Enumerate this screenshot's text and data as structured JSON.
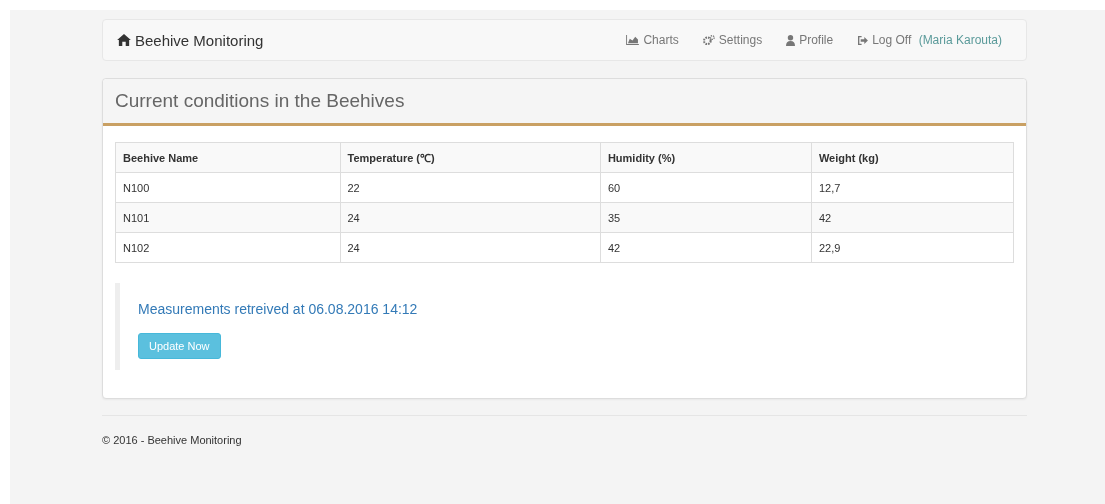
{
  "brand": {
    "label": "Beehive Monitoring"
  },
  "nav": [
    {
      "kind": "charts",
      "label": "Charts"
    },
    {
      "kind": "settings",
      "label": "Settings"
    },
    {
      "kind": "profile",
      "label": "Profile"
    },
    {
      "kind": "logoff",
      "label": "Log Off",
      "user": "(Maria Karouta)"
    }
  ],
  "panel": {
    "title": "Current conditions in the Beehives"
  },
  "table": {
    "columns": [
      "Beehive Name",
      "Temperature (℃)",
      "Humidity (%)",
      "Weight (kg)"
    ],
    "rows": [
      [
        "N100",
        "22",
        "60",
        "12,7"
      ],
      [
        "N101",
        "24",
        "35",
        "42"
      ],
      [
        "N102",
        "24",
        "42",
        "22,9"
      ]
    ]
  },
  "status": {
    "message": "Measurements retreived at 06.08.2016 14:12",
    "button": "Update Now"
  },
  "footer": "© 2016 - Beehive Monitoring"
}
